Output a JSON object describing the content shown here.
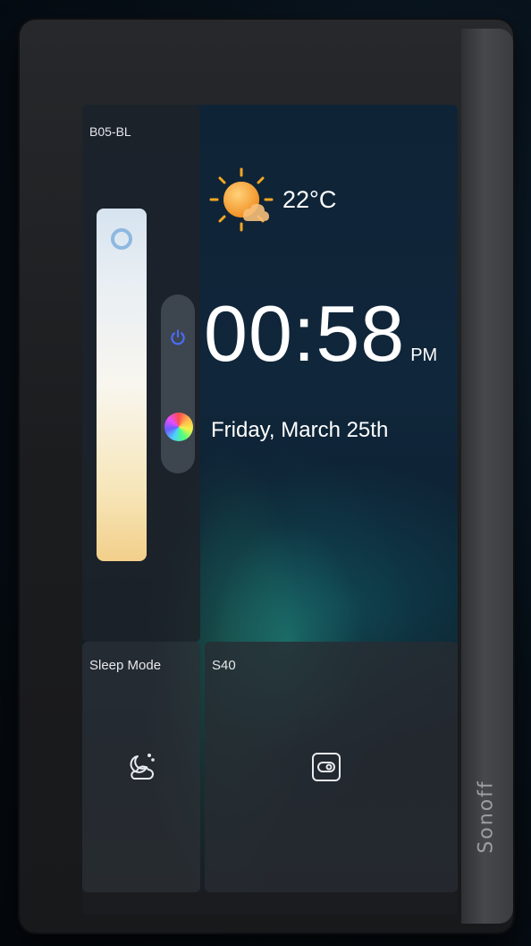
{
  "device": {
    "brand": "Sonoff"
  },
  "light_panel": {
    "name": "B05-BL",
    "power_icon": "power-icon",
    "color_icon": "color-wheel-icon"
  },
  "weather": {
    "icon": "sun-cloud-icon",
    "temperature": "22°C"
  },
  "clock": {
    "time": "00:58",
    "period": "PM",
    "date": "Friday, March 25th"
  },
  "tiles": [
    {
      "label": "Sleep Mode",
      "icon": "moon-cloud-icon"
    },
    {
      "label": "S40",
      "icon": "switch-plug-icon"
    }
  ],
  "colors": {
    "power_blue": "#4a6cf7",
    "knob_blue": "#8db8e0",
    "sun_orange": "#f5a623"
  }
}
